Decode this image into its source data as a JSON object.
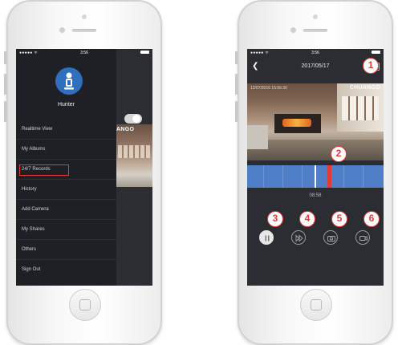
{
  "left_screen": {
    "status": {
      "signal": "●●●●● ᯤ",
      "time": "3:56"
    },
    "user": {
      "name": "Hunter"
    },
    "menu": [
      {
        "label": "Realtime View"
      },
      {
        "label": "My Albums"
      },
      {
        "label": "24/7 Records",
        "highlighted": true
      },
      {
        "label": "History"
      },
      {
        "label": "Add Camera"
      },
      {
        "label": "My Shares"
      },
      {
        "label": "Others"
      },
      {
        "label": "Sign Out"
      }
    ],
    "peek_logo": "ANGO",
    "toggle_on": false
  },
  "right_screen": {
    "status": {
      "signal": "●●●●● ᯤ",
      "time": "3:56"
    },
    "back_icon": "chevron-left-icon",
    "date": "2017/05/17",
    "video_timestamp": "12/07/2016 15:56:30",
    "video_logo": "CHUANGO",
    "playback_time": "08:58",
    "controls": [
      {
        "name": "pause",
        "icon": "pause-icon",
        "active": true
      },
      {
        "name": "fast-forward",
        "icon": "fast-forward-icon",
        "active": false
      },
      {
        "name": "snapshot",
        "icon": "camera-icon",
        "active": false
      },
      {
        "name": "record",
        "icon": "video-icon",
        "active": false
      }
    ]
  },
  "callouts": [
    "1",
    "2",
    "3",
    "4",
    "5",
    "6"
  ],
  "colors": {
    "highlight": "#e53935",
    "timeline": "#4f7fc9",
    "avatar": "#2f6fbd",
    "drawer": "#1e2025"
  }
}
